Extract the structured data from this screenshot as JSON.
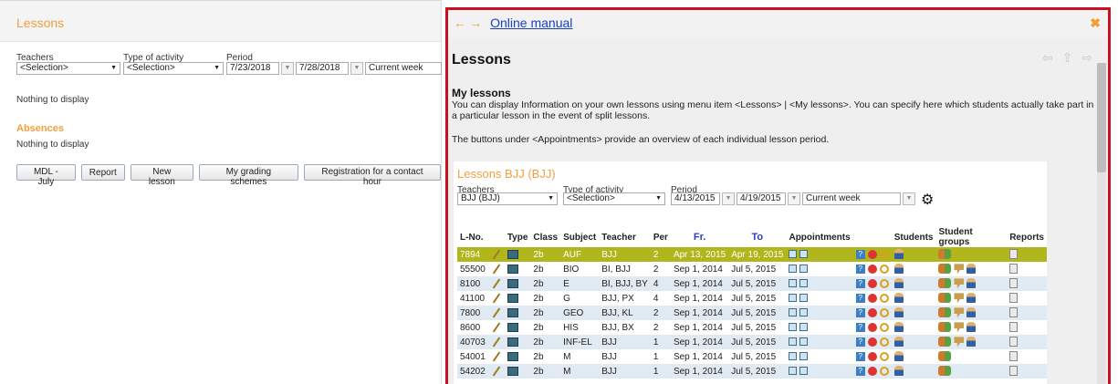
{
  "left": {
    "title": "Lessons",
    "filters": {
      "teachers_label": "Teachers",
      "teachers_value": "<Selection>",
      "activity_label": "Type of activity",
      "activity_value": "<Selection>",
      "period_label": "Period",
      "date_from": "7/23/2018",
      "date_to": "7/28/2018",
      "period_value": "Current week"
    },
    "nothing1": "Nothing to display",
    "absences_title": "Absences",
    "nothing2": "Nothing to display",
    "buttons": [
      "MDL - July",
      "Report",
      "New lesson",
      "My grading schemes",
      "Registration for a contact hour"
    ]
  },
  "right": {
    "manual_link": "Online manual",
    "heading": "Lessons",
    "subheading": "My lessons",
    "para1": "You can display Information on your own lessons using menu item <Lessons> | <My lessons>. You can specify here which students actually take part in a particular lesson in the event of split lessons.",
    "para2": "The buttons under <Appointments> provide an overview of each individual lesson period.",
    "inner": {
      "title": "Lessons BJJ (BJJ)",
      "teachers_label": "Teachers",
      "teachers_value": "BJJ (BJJ)",
      "activity_label": "Type of activity",
      "activity_value": "<Selection>",
      "period_label": "Period",
      "date_from": "4/13/2015",
      "date_to": "4/19/2015",
      "period_value": "Current week",
      "columns": [
        "L-No.",
        "",
        "Type",
        "Class",
        "Subject",
        "Teacher",
        "Per",
        "Fr.",
        "To",
        "Appointments",
        "",
        "Students",
        "Student groups",
        "Reports"
      ],
      "rows": [
        {
          "no": "7894",
          "class": "2b",
          "subject": "AUF",
          "teacher": "BJJ",
          "per": "2",
          "from": "Apr 13, 2015",
          "to": "Apr 19, 2015",
          "groups": 1
        },
        {
          "no": "55500",
          "class": "2b",
          "subject": "BIO",
          "teacher": "BI, BJJ",
          "per": "2",
          "from": "Sep 1, 2014",
          "to": "Jul 5, 2015",
          "groups": 3
        },
        {
          "no": "8100",
          "class": "2b",
          "subject": "E",
          "teacher": "BI, BJJ, BY",
          "per": "4",
          "from": "Sep 1, 2014",
          "to": "Jul 5, 2015",
          "groups": 3
        },
        {
          "no": "41100",
          "class": "2b",
          "subject": "G",
          "teacher": "BJJ, PX",
          "per": "4",
          "from": "Sep 1, 2014",
          "to": "Jul 5, 2015",
          "groups": 3
        },
        {
          "no": "7800",
          "class": "2b",
          "subject": "GEO",
          "teacher": "BJJ, KL",
          "per": "2",
          "from": "Sep 1, 2014",
          "to": "Jul 5, 2015",
          "groups": 3
        },
        {
          "no": "8600",
          "class": "2b",
          "subject": "HIS",
          "teacher": "BJJ, BX",
          "per": "2",
          "from": "Sep 1, 2014",
          "to": "Jul 5, 2015",
          "groups": 3
        },
        {
          "no": "40703",
          "class": "2b",
          "subject": "INF-EL",
          "teacher": "BJJ",
          "per": "1",
          "from": "Sep 1, 2014",
          "to": "Jul 5, 2015",
          "groups": 3
        },
        {
          "no": "54001",
          "class": "2b",
          "subject": "M",
          "teacher": "BJJ",
          "per": "1",
          "from": "Sep 1, 2014",
          "to": "Jul 5, 2015",
          "groups": 1
        },
        {
          "no": "54202",
          "class": "2b",
          "subject": "M",
          "teacher": "BJJ",
          "per": "1",
          "from": "Sep 1, 2014",
          "to": "Jul 5, 2015",
          "groups": 1
        }
      ]
    }
  },
  "colors": {
    "accent": "#f0a040",
    "frame": "#c8101e",
    "selected_row": "#b0b61c",
    "alt_row": "#dfeaf3",
    "link": "#1a3fbf"
  }
}
